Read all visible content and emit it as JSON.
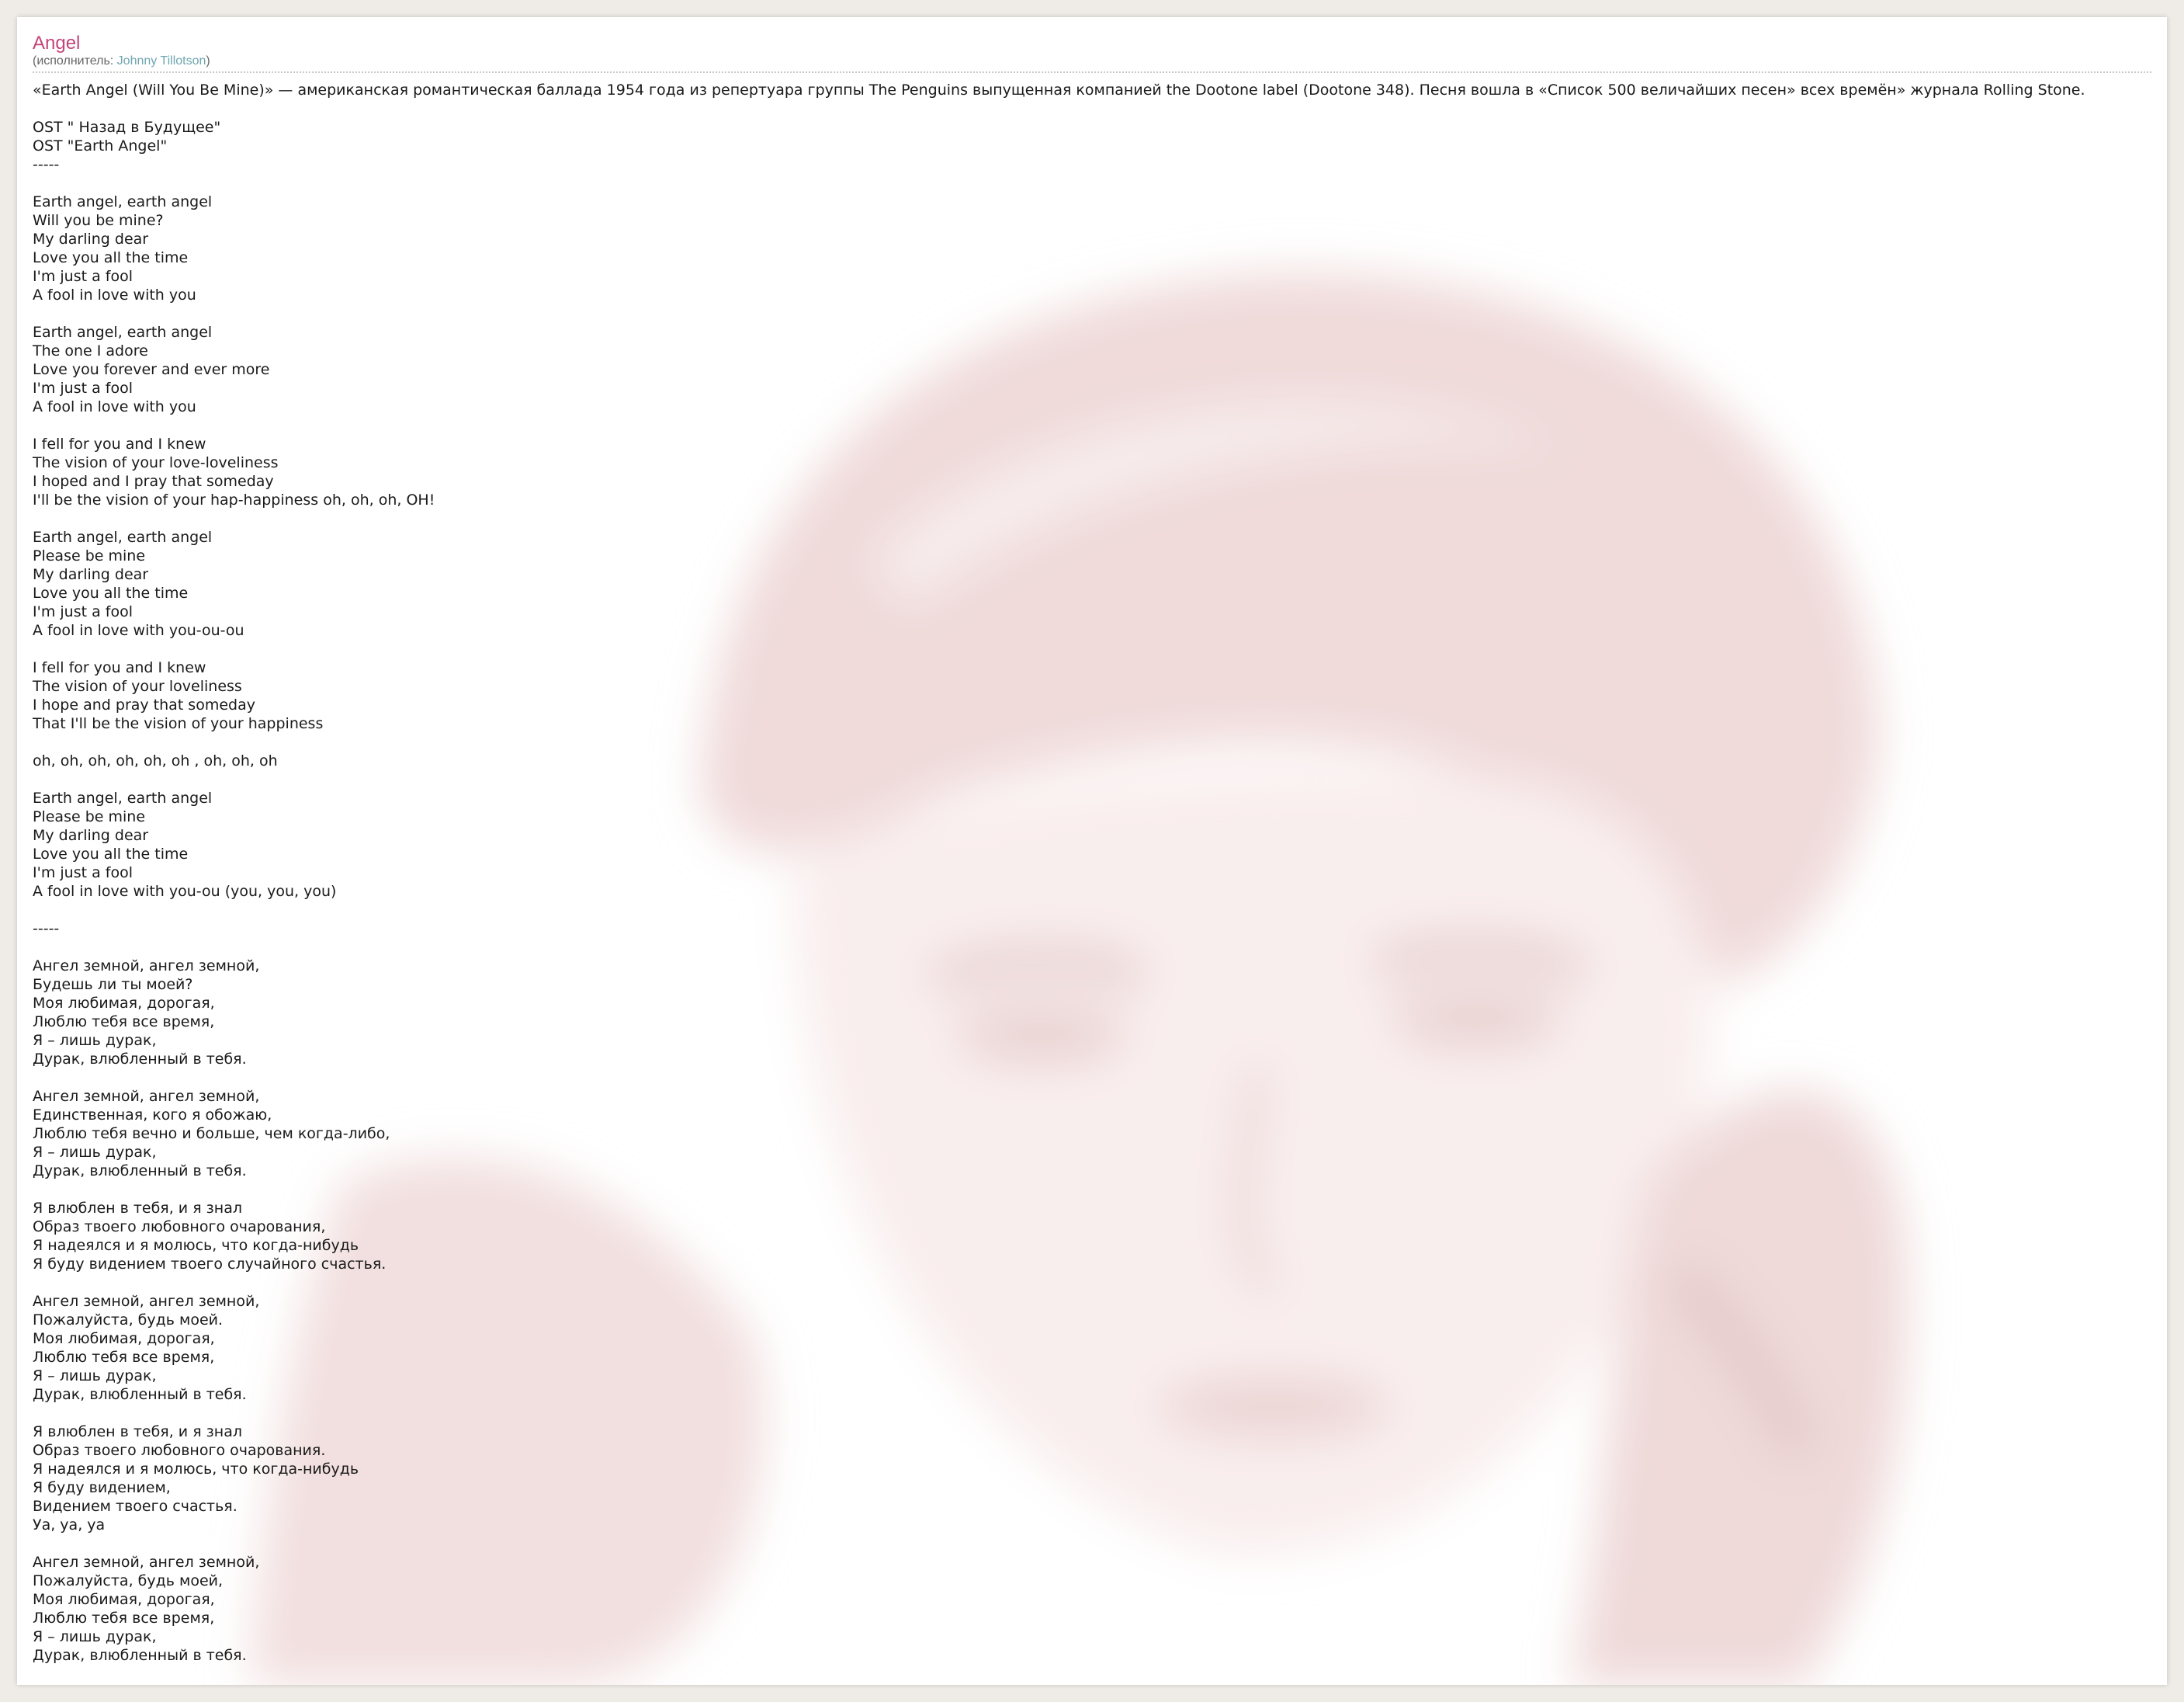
{
  "theme": {
    "title_color": "#c2457a",
    "link_color": "#6fa6b0",
    "background": "#efebe6",
    "photo_tint": "#f3dede"
  },
  "song": {
    "title": "Angel",
    "artist_prefix": "(исполнитель: ",
    "artist_name": "Johnny Tillotson",
    "artist_suffix": ")"
  },
  "lyrics": {
    "text": "«Earth Angel (Will You Be Mine)» — американская романтическая баллада 1954 года из репертуара группы The Penguins выпущенная компанией the Dootone label (Dootone 348). Песня вошла в «Список 500 величайших песен» всех времён» журнала Rolling Stone.\n\nOST \" Назад в Будущее\"\nOST \"Earth Angel\"\n-----\n\nEarth angel, earth angel\nWill you be mine?\nMy darling dear\nLove you all the time\nI'm just a fool\nA fool in love with you\n\nEarth angel, earth angel\nThe one I adore\nLove you forever and ever more\nI'm just a fool\nA fool in love with you\n\nI fell for you and I knew\nThe vision of your love-loveliness\nI hoped and I pray that someday\nI'll be the vision of your hap-happiness oh, oh, oh, OH!\n\nEarth angel, earth angel\nPlease be mine\nMy darling dear\nLove you all the time\nI'm just a fool\nA fool in love with you-ou-ou\n\nI fell for you and I knew\nThe vision of your loveliness\nI hope and pray that someday\nThat I'll be the vision of your happiness\n\noh, oh, oh, oh, oh, oh , oh, oh, oh\n\nEarth angel, earth angel\nPlease be mine\nMy darling dear\nLove you all the time\nI'm just a fool\nA fool in love with you-ou (you, you, you)\n\n-----\n\nАнгел земной, ангел земной,\nБудешь ли ты моей?\nМоя любимая, дорогая,\nЛюблю тебя все время,\nЯ – лишь дурак,\nДурак, влюбленный в тебя.\n\nАнгел земной, ангел земной,\nЕдинственная, кого я обожаю,\nЛюблю тебя вечно и больше, чем когда-либо,\nЯ – лишь дурак,\nДурак, влюбленный в тебя.\n\nЯ влюблен в тебя, и я знал\nОбраз твоего любовного очарования,\nЯ надеялся и я молюсь, что когда-нибудь\nЯ буду видением твоего случайного счастья.\n\nАнгел земной, ангел земной,\nПожалуйста, будь моей.\nМоя любимая, дорогая,\nЛюблю тебя все время,\nЯ – лишь дурак,\nДурак, влюбленный в тебя.\n\nЯ влюблен в тебя, и я знал\nОбраз твоего любовного очарования.\nЯ надеялся и я молюсь, что когда-нибудь\nЯ буду видением,\nВидением твоего счастья.\nУа, уа, уа\n\nАнгел земной, ангел земной,\nПожалуйста, будь моей,\nМоя любимая, дорогая,\nЛюблю тебя все время,\nЯ – лишь дурак,\nДурак, влюбленный в тебя."
  }
}
